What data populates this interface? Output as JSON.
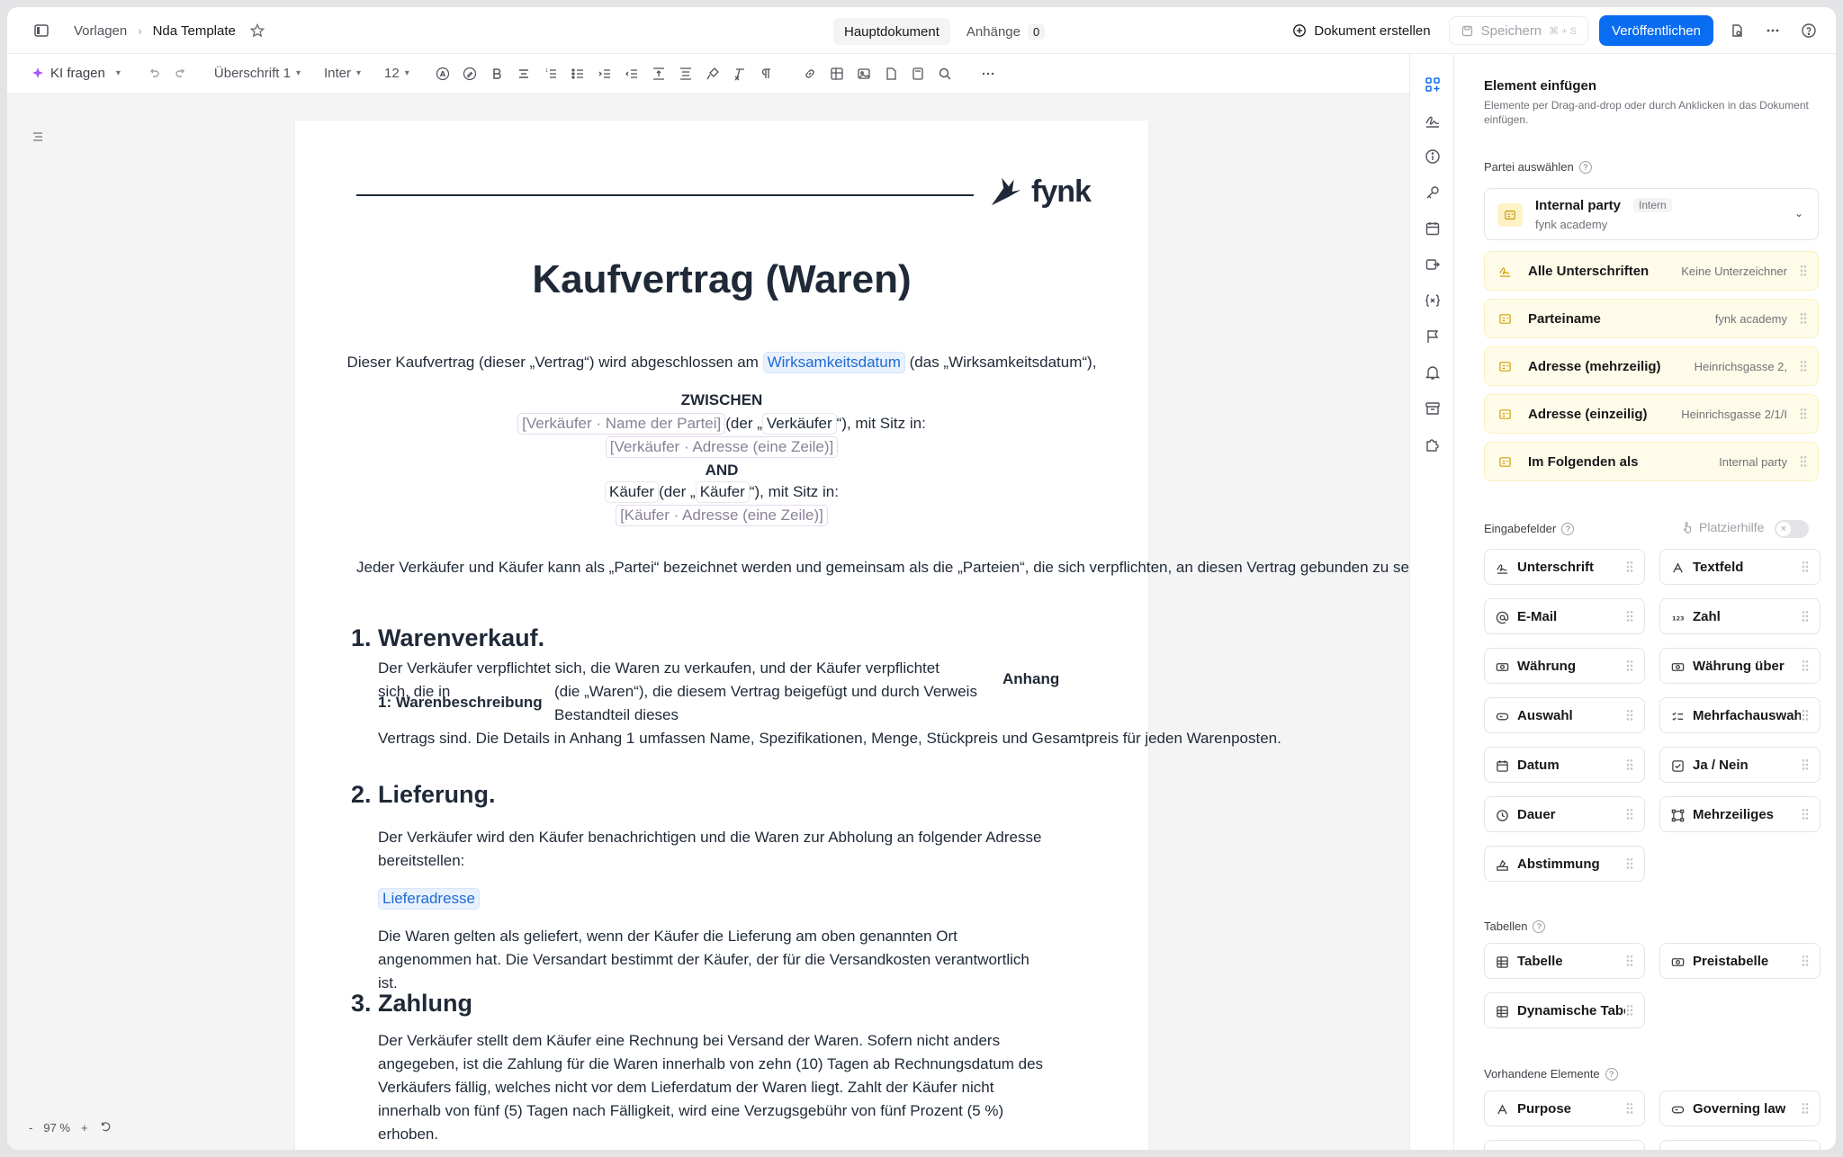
{
  "topbar": {
    "breadcrumb_parent": "Vorlagen",
    "breadcrumb_current": "Nda Template",
    "tab_main": "Hauptdokument",
    "tab_attachments": "Anhänge",
    "attachments_count": "0",
    "create_document": "Dokument erstellen",
    "save": "Speichern",
    "save_shortcut": "⌘ + S",
    "publish": "Veröffentlichen"
  },
  "toolbar": {
    "ki": "KI fragen",
    "heading_style": "Überschrift 1",
    "font": "Inter",
    "font_size": "12"
  },
  "document": {
    "logo_text": "fynk",
    "title": "Kaufvertrag (Waren)",
    "intro_pre": "Dieser Kaufvertrag (dieser „Vertrag“) wird abgeschlossen am",
    "intro_chip": "Wirksamkeitsdatum",
    "intro_post": "(das „Wirksamkeitsdatum“),",
    "between": "ZWISCHEN",
    "seller_name_chip": "[Verkäufer · Name der Partei]",
    "seller_alias_pre": "(der „",
    "seller_alias_chip": "Verkäufer",
    "seller_alias_post": "“), mit Sitz in:",
    "seller_address_chip": "[Verkäufer · Adresse (eine Zeile)]",
    "and": "AND",
    "buyer_name_chip": "Käufer",
    "buyer_alias_pre": "(der „",
    "buyer_alias_chip": "Käufer",
    "buyer_alias_post": "“), mit Sitz in:",
    "buyer_address_chip": "[Käufer · Adresse (eine Zeile)]",
    "parties_sentence": "Jeder Verkäufer und Käufer kann als „Partei“ bezeichnet werden und gemeinsam als die „Parteien“, die sich verpflichten, an diesen Vertrag gebunden zu sein.",
    "s1_num": "1.",
    "s1_title": "Warenverkauf.",
    "s1_line1": "Der Verkäufer verpflichtet sich, die Waren zu verkaufen, und der Käufer verpflichtet",
    "s1_line2a": "sich, die in",
    "s1_anhang": "Anhang",
    "s1_line2b": "(die „Waren“), die diesem Vertrag beigefügt und durch Verweis",
    "s1_ware_label": "1: Warenbeschreibung",
    "s1_line3": "Bestandteil dieses",
    "s1_line4": "Vertrags sind. Die Details in Anhang 1 umfassen Name, Spezifikationen, Menge, Stückpreis und Gesamtpreis für jeden Warenposten.",
    "s2_num": "2.",
    "s2_title": "Lieferung.",
    "s2_line1": "Der Verkäufer wird den Käufer benachrichtigen und die Waren zur Abholung an folgender Adresse",
    "s2_line2": "bereitstellen:",
    "s2_chip": "Lieferadresse",
    "s2_line3": "Die Waren gelten als geliefert, wenn der Käufer die Lieferung am oben genannten Ort",
    "s2_line4": "angenommen hat. Die Versandart bestimmt der Käufer, der für die Versandkosten verantwortlich",
    "s2_line5": "ist.",
    "s3_num": "3.",
    "s3_title": "Zahlung",
    "s3_line1": "Der Verkäufer stellt dem Käufer eine Rechnung bei Versand der Waren. Sofern nicht anders",
    "s3_line2": "angegeben, ist die Zahlung für die Waren innerhalb von zehn (10) Tagen ab Rechnungsdatum des",
    "s3_line3": "Verkäufers fällig, welches nicht vor dem Lieferdatum der Waren liegt. Zahlt der Käufer nicht",
    "s3_line4": "innerhalb von fünf (5) Tagen nach Fälligkeit, wird eine Verzugsgebühr von fünf Prozent (5 %)",
    "s3_line5": "erhoben."
  },
  "zoom": {
    "minus": "-",
    "value": "97 %",
    "plus": "+"
  },
  "panel": {
    "title": "Element einfügen",
    "subtitle": "Elemente per Drag-and-drop oder durch Anklicken in das Dokument einfügen.",
    "party_section": "Partei auswählen",
    "party_name": "Internal party",
    "party_badge": "Intern",
    "party_org": "fynk academy",
    "party_rows": [
      {
        "label": "Alle Unterschriften",
        "value": "Keine Unterzeichner"
      },
      {
        "label": "Parteiname",
        "value": "fynk academy"
      },
      {
        "label": "Adresse (mehrzeilig)",
        "value": "Heinrichsgasse 2,"
      },
      {
        "label": "Adresse (einzeilig)",
        "value": "Heinrichsgasse 2/1/I"
      },
      {
        "label": "Im Folgenden als",
        "value": "Internal party"
      }
    ],
    "inputs_section": "Eingabefelder",
    "placement_helper": "Platzierhilfe",
    "input_fields": [
      {
        "label": "Unterschrift",
        "icon": "signature-icon"
      },
      {
        "label": "Textfeld",
        "icon": "text-icon"
      },
      {
        "label": "E-Mail",
        "icon": "at-icon"
      },
      {
        "label": "Zahl",
        "icon": "number-icon"
      },
      {
        "label": "Währung",
        "icon": "currency-icon"
      },
      {
        "label": "Währung über",
        "icon": "currency-icon"
      },
      {
        "label": "Auswahl",
        "icon": "select-icon"
      },
      {
        "label": "Mehrfachauswahl",
        "icon": "multiselect-icon"
      },
      {
        "label": "Datum",
        "icon": "calendar-icon"
      },
      {
        "label": "Ja / Nein",
        "icon": "checkbox-icon"
      },
      {
        "label": "Dauer",
        "icon": "clock-icon"
      },
      {
        "label": "Mehrzeiliges",
        "icon": "textarea-icon"
      },
      {
        "label": "Abstimmung",
        "icon": "vote-icon"
      }
    ],
    "tables_section": "Tabellen",
    "table_fields": [
      {
        "label": "Tabelle",
        "icon": "table-icon"
      },
      {
        "label": "Preistabelle",
        "icon": "price-table-icon"
      },
      {
        "label": "Dynamische Tabelle",
        "icon": "table-icon"
      }
    ],
    "existing_section": "Vorhandene Elemente",
    "existing_fields": [
      {
        "label": "Purpose",
        "icon": "text-icon"
      },
      {
        "label": "Governing law",
        "icon": "select-icon"
      }
    ]
  }
}
